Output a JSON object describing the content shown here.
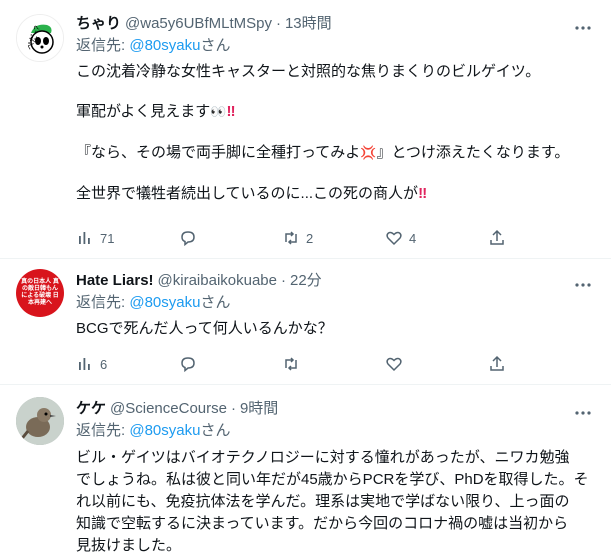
{
  "tweets": [
    {
      "name": "ちゃり",
      "handle": "@wa5y6UBfMLtMSpy",
      "dot": "·",
      "time": "13時間",
      "reply_prefix": "返信先: ",
      "reply_mention": "@80syaku",
      "reply_suffix": "さん",
      "lines": [
        "この沈着冷静な女性キャスターと対照的な焦りまくりのビルゲイツ。",
        "軍配がよく見えます",
        "『なら、その場で両手脚に全種打ってみよ",
        "』とつけ添えたくなります。",
        "全世界で犠牲者続出しているのに...この死の商人が"
      ],
      "emoji_eyes": "👀",
      "emoji_bang": "‼",
      "emoji_anger": "💢",
      "stats": {
        "views": "71",
        "replies": "",
        "retweets": "2",
        "likes": "4"
      }
    },
    {
      "name": "Hate Liars!",
      "handle": "@kiraibaikokuabe",
      "dot": "·",
      "time": "22分",
      "reply_prefix": "返信先: ",
      "reply_mention": "@80syaku",
      "reply_suffix": "さん",
      "lines": [
        "BCGで死んだ人って何人いるんかな？"
      ],
      "avatar_text": "真の日本人 真の敵日韓もんによる破壊 日本再建へ",
      "stats": {
        "views": "6",
        "replies": "",
        "retweets": "",
        "likes": ""
      }
    },
    {
      "name": "ケケ",
      "handle": "@ScienceCourse",
      "dot": "·",
      "time": "9時間",
      "reply_prefix": "返信先: ",
      "reply_mention": "@80syaku",
      "reply_suffix": "さん",
      "lines": [
        "ビル・ゲイツはバイオテクノロジーに対する憧れがあったが、ニワカ勉強",
        "でしょうね。私は彼と同い年だが45歳からPCRを学び、PhDを取得した。そ",
        "れ以前にも、免疫抗体法を学んだ。理系は実地で学ばない限り、上っ面の",
        "知識で空転するに決まっています。だから今回のコロナ禍の嘘は当初から",
        "見抜けました。"
      ]
    }
  ],
  "colors": {
    "text": "#0f1419",
    "secondary": "#536471",
    "link": "#1d9bf0",
    "divider": "#eff3f4",
    "red": "#e0245e"
  }
}
